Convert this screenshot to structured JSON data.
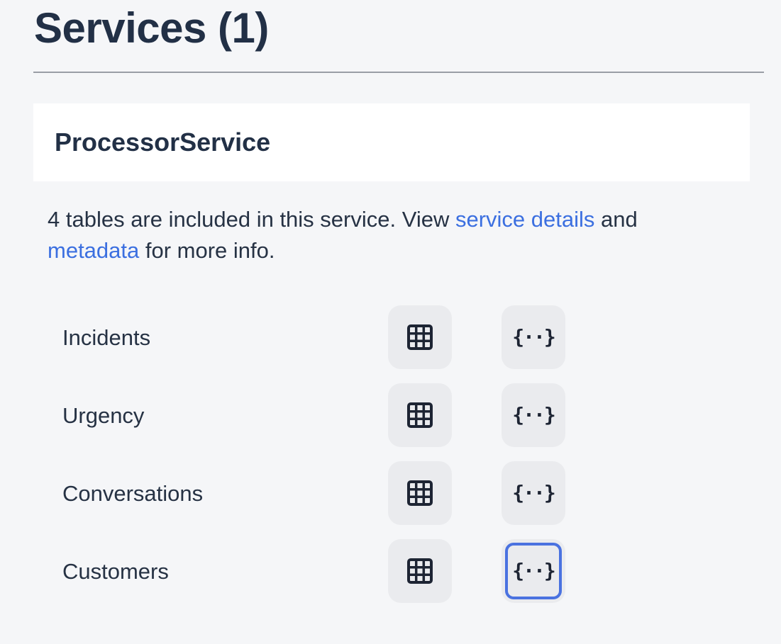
{
  "header": {
    "title": "Services (1)"
  },
  "service": {
    "name": "ProcessorService",
    "description": {
      "prefix": "4 tables are included in this service. View ",
      "details_link": "service details",
      "middle": " and ",
      "metadata_link": "metadata",
      "suffix": " for more info."
    },
    "entities": [
      {
        "name": "Incidents"
      },
      {
        "name": "Urgency"
      },
      {
        "name": "Conversations"
      },
      {
        "name": "Customers"
      }
    ]
  },
  "icons": {
    "table": "table-grid-icon",
    "json": "curly-braces-icon",
    "json_glyph": "{··}"
  },
  "colors": {
    "link": "#3b6fe0",
    "focus": "#4a72e0",
    "title": "#223046"
  }
}
